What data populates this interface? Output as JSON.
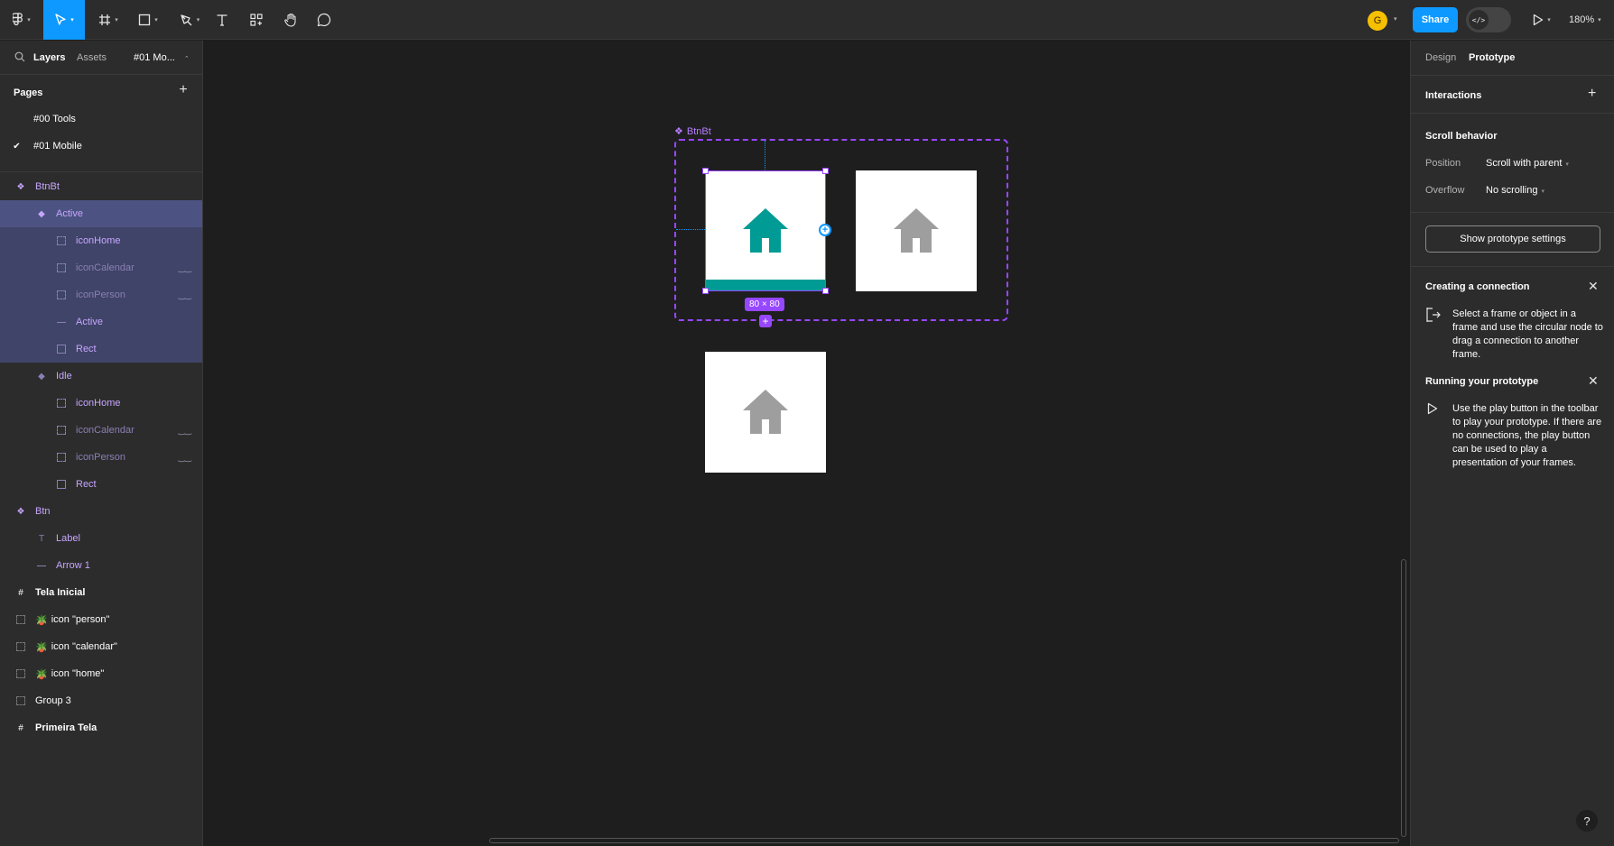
{
  "toolbar": {
    "tools": [
      {
        "icon": "figma-menu-icon"
      },
      {
        "icon": "move-tool-icon",
        "active": true
      },
      {
        "icon": "frame-tool-icon"
      },
      {
        "icon": "rectangle-tool-icon"
      },
      {
        "icon": "pen-tool-icon"
      },
      {
        "icon": "text-tool-icon"
      },
      {
        "icon": "components-icon"
      },
      {
        "icon": "hand-tool-icon"
      },
      {
        "icon": "comment-icon"
      }
    ],
    "avatar_initial": "G",
    "share_label": "Share",
    "devmode_icon": "</>",
    "zoom": "180%"
  },
  "left_panel": {
    "tabs": [
      "Layers",
      "Assets"
    ],
    "page_selector": "#01 Mo...",
    "pages_title": "Pages",
    "pages": [
      {
        "name": "#00 Tools",
        "current": false
      },
      {
        "name": "#01 Mobile",
        "current": true
      }
    ],
    "layers": [
      {
        "name": "BtnBt",
        "icon": "component-set-icon"
      },
      {
        "name": "Active",
        "icon": "variant-icon"
      },
      {
        "name": "iconHome",
        "icon": "instance-frame-icon"
      },
      {
        "name": "iconCalendar",
        "icon": "instance-frame-icon",
        "hidden": true
      },
      {
        "name": "iconPerson",
        "icon": "instance-frame-icon",
        "hidden": true
      },
      {
        "name": "Active",
        "icon": "line-icon"
      },
      {
        "name": "Rect",
        "icon": "rect-icon"
      },
      {
        "name": "Idle",
        "icon": "variant-icon"
      },
      {
        "name": "iconHome",
        "icon": "instance-frame-icon"
      },
      {
        "name": "iconCalendar",
        "icon": "instance-frame-icon",
        "hidden": true
      },
      {
        "name": "iconPerson",
        "icon": "instance-frame-icon",
        "hidden": true
      },
      {
        "name": "Rect",
        "icon": "rect-icon"
      },
      {
        "name": "Btn",
        "icon": "component-set-icon"
      },
      {
        "name": "Label",
        "icon": "text-layer-icon"
      },
      {
        "name": "Arrow 1",
        "icon": "line-icon"
      },
      {
        "name": "Tela Inicial",
        "icon": "frame-icon"
      },
      {
        "name": "icon \"person\"",
        "icon": "group-icon"
      },
      {
        "name": "icon \"calendar\"",
        "icon": "group-icon"
      },
      {
        "name": "icon \"home\"",
        "icon": "group-icon"
      },
      {
        "name": "Group 3",
        "icon": "group-icon"
      },
      {
        "name": "Primeira Tela",
        "icon": "frame-icon"
      }
    ],
    "hidden_marker": "‿‿"
  },
  "canvas": {
    "component_label": "BtnBt",
    "size_badge": "80 × 80",
    "colors": {
      "active_house": "#009b94",
      "idle_house": "#9e9e9e",
      "selection": "#9747ff"
    }
  },
  "right_panel": {
    "tabs": [
      "Design",
      "Prototype"
    ],
    "interactions_title": "Interactions",
    "scroll_behavior_title": "Scroll behavior",
    "position_label": "Position",
    "position_value": "Scroll with parent",
    "overflow_label": "Overflow",
    "overflow_value": "No scrolling",
    "show_settings_button": "Show prototype settings",
    "tip1_title": "Creating a connection",
    "tip1_text": "Select a frame or object in a frame and use the circular node to drag a connection to another frame.",
    "tip2_title": "Running your prototype",
    "tip2_text": "Use the play button in the toolbar to play your prototype. If there are no connections, the play button can be used to play a presentation of your frames.",
    "help": "?"
  }
}
